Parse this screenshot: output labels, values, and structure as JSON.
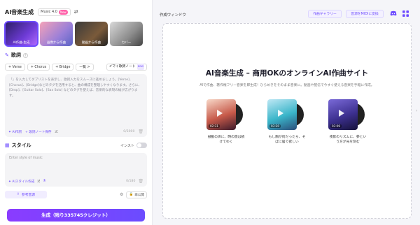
{
  "app": {
    "title": "AI音楽生成",
    "version": "Music 4.0",
    "version_badge": "New"
  },
  "modes": [
    {
      "label": "AI作曲-生成",
      "active": true
    },
    {
      "label": "画像から作曲",
      "active": false
    },
    {
      "label": "動画から作曲",
      "active": false
    },
    {
      "label": "カバー",
      "active": false
    }
  ],
  "lyrics": {
    "title": "歌詞",
    "tags": [
      "+ Verse",
      "+ Chorus",
      "+ Bridge",
      "一覧 >"
    ],
    "my_notes": "マイ歌詞ノート",
    "my_notes_badge": "NEW",
    "placeholder": "「」を入力してダブリストを表示し、歌詞入力をスムーズに進めましょう。[Verse]、[Chorus]、[Bridge]などのタグを活用すると、曲の構成を整理しやすくなります。さらに、[Drop]、[Guitar Solo]、[Sax Solo] などのタグを使えば、音楽的な表現の幅が広がります。",
    "ai_lyrics": "AI作詞",
    "apply_notes": "歌詞ノート保存",
    "counter": "0/3000"
  },
  "style": {
    "title": "スタイル",
    "instrumental_label": "インスト",
    "placeholder": "Enter style of music",
    "ai_style": "AIスタイル作成",
    "counter": "0/180"
  },
  "bottom": {
    "reference_audio": "参考音源",
    "public_label": "非公開",
    "generate_button": "生成（残り335745クレジット）"
  },
  "workspace": {
    "title": "作成ウィンドウ",
    "gallery_button": "作曲ギャラリー",
    "midi_button": "音源をMIDIに変換",
    "hero_title": "AI音楽生成 – 商用OKのオンラインAI作曲サイト",
    "hero_subtitle": "AIで作曲、著作権フリー音楽を即生成！ひらめきをそのまま音楽に。動画や配信で今すぐ使える音楽を手軽に作成。",
    "cards": [
      {
        "duration": "02:31",
        "text": "鼓動の声に、時の旅は続けてゆく"
      },
      {
        "duration": "03:20",
        "text": "もし胸が何だったら、そばに居て欲しい"
      },
      {
        "duration": "03:09",
        "text": "夜影のリズムに、夢という方が光を刻む"
      }
    ]
  },
  "colors": {
    "accent": "#6d4bff",
    "generate_start": "#8a3cff",
    "generate_end": "#6b4cff",
    "new_badge": "#ff5fa8"
  },
  "icons": [
    "swap-icon",
    "lyrics-icon",
    "help-icon",
    "note-icon",
    "ai-icon",
    "shuffle-icon",
    "trash-icon",
    "style-icon",
    "upload-icon",
    "gear-icon",
    "lock-icon",
    "discord-icon",
    "grid-icon",
    "play-icon"
  ]
}
